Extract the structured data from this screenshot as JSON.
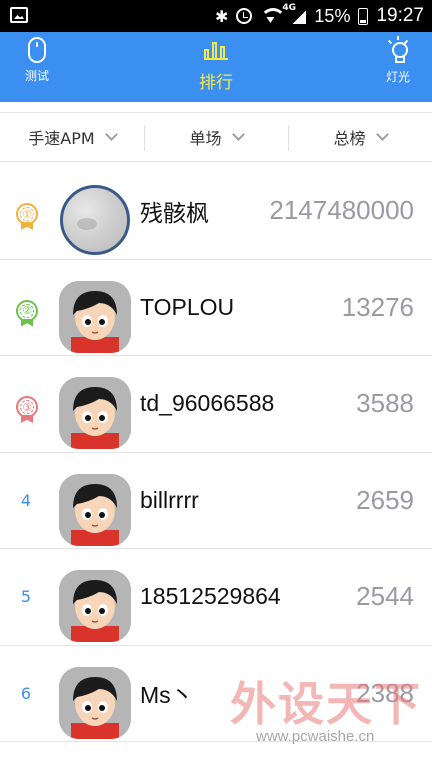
{
  "status_bar": {
    "network": "4G",
    "battery": "15%",
    "time": "19:27"
  },
  "header": {
    "nav": [
      {
        "label": "测试",
        "icon": "mouse-icon"
      },
      {
        "label": "排行",
        "icon": "bar-chart-icon",
        "active": true
      },
      {
        "label": "灯光",
        "icon": "lightbulb-icon"
      }
    ]
  },
  "filters": [
    {
      "label": "手速APM"
    },
    {
      "label": "单场"
    },
    {
      "label": "总榜"
    }
  ],
  "ranking": [
    {
      "rank": "①",
      "name": "残骸枫",
      "score": "2147480000",
      "medal": "gold"
    },
    {
      "rank": "②",
      "name": "TOPLOU",
      "score": "13276",
      "medal": "silver"
    },
    {
      "rank": "③",
      "name": "td_96066588",
      "score": "3588",
      "medal": "bronze"
    },
    {
      "rank": "4",
      "name": "billrrrr",
      "score": "2659"
    },
    {
      "rank": "5",
      "name": "18512529864",
      "score": "2544"
    },
    {
      "rank": "6",
      "name": "Ms丶",
      "score": "2388"
    }
  ],
  "watermark": {
    "title": "外设天下",
    "url": "www.pcwaishe.cn"
  },
  "colors": {
    "accent": "#3b8ff0",
    "active_nav": "#f7e84a",
    "score": "#9a9aa6",
    "gold": "#f0b23c",
    "silver": "#6bc24a",
    "bronze": "#e9787e"
  }
}
